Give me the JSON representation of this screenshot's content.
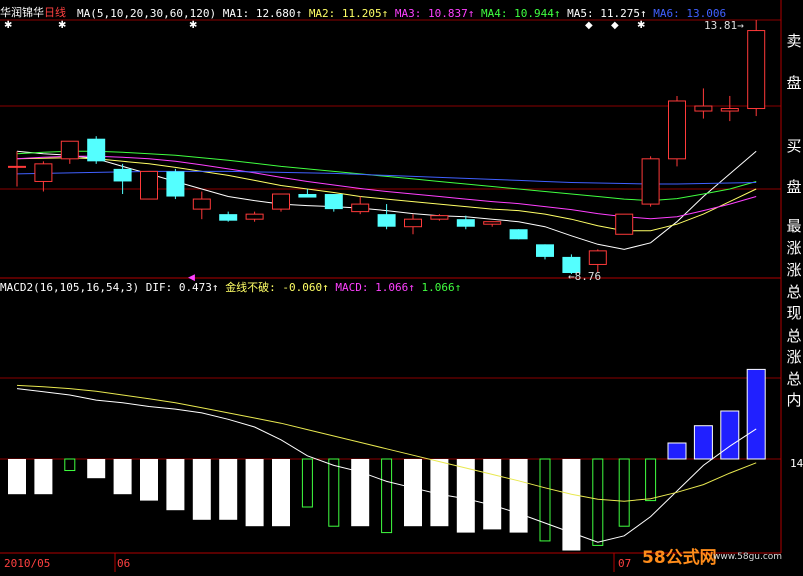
{
  "stock": {
    "name": "华润锦华",
    "period": "日线"
  },
  "ma_header": {
    "label": "MA(5,10,20,30,60,120)",
    "ma1": "MA1: 12.680↑",
    "ma2": "MA2: 11.205↑",
    "ma3": "MA3: 10.837↑",
    "ma4": "MA4: 10.944↑",
    "ma5": "MA5: 11.275↑",
    "ma6": "MA6: 13.006"
  },
  "macd_header": {
    "label": "MACD2(16,105,16,54,3)",
    "dif": "DIF: 0.473↑",
    "cross": "金线不破: -0.060↑",
    "macd": "MACD: 1.066↑",
    "extra": "1.066↑"
  },
  "annotations": {
    "high": "13.81",
    "low": "8.76",
    "right_value": "14"
  },
  "axis_dates": [
    "2010/05",
    "06",
    "07"
  ],
  "side_panel": [
    "卖",
    "盘",
    "买",
    "盘",
    "最",
    "涨",
    "涨",
    "总",
    "现",
    "总",
    "涨",
    "总",
    "内"
  ],
  "watermark": {
    "main": "58公式网",
    "url": "www.58gu.com"
  },
  "colors": {
    "up": "#ff3a3a",
    "down": "#54ffff",
    "grid": "#8a0000",
    "ma1": "#ffffff",
    "ma2": "#ffff66",
    "ma3": "#ff40ff",
    "ma4": "#40ff40",
    "ma5": "#4060ff",
    "dif": "#ffffff",
    "signal": "#e8e850"
  },
  "chart_data": {
    "type": "candlestick",
    "candles": [
      {
        "o": 10.9,
        "h": 11.2,
        "l": 10.5,
        "c": 10.9
      },
      {
        "o": 10.6,
        "h": 11.0,
        "l": 10.4,
        "c": 10.95
      },
      {
        "o": 11.05,
        "h": 11.4,
        "l": 10.95,
        "c": 11.4
      },
      {
        "o": 11.45,
        "h": 11.5,
        "l": 10.95,
        "c": 11.0
      },
      {
        "o": 10.85,
        "h": 10.95,
        "l": 10.35,
        "c": 10.6
      },
      {
        "o": 10.25,
        "h": 10.8,
        "l": 10.25,
        "c": 10.8
      },
      {
        "o": 10.8,
        "h": 10.85,
        "l": 10.25,
        "c": 10.3
      },
      {
        "o": 10.05,
        "h": 10.4,
        "l": 9.85,
        "c": 10.25
      },
      {
        "o": 9.95,
        "h": 10.0,
        "l": 9.8,
        "c": 9.82
      },
      {
        "o": 9.85,
        "h": 10.0,
        "l": 9.8,
        "c": 9.95
      },
      {
        "o": 10.05,
        "h": 10.35,
        "l": 10.0,
        "c": 10.35
      },
      {
        "o": 10.35,
        "h": 10.45,
        "l": 10.3,
        "c": 10.28
      },
      {
        "o": 10.35,
        "h": 10.35,
        "l": 10.0,
        "c": 10.05
      },
      {
        "o": 10.0,
        "h": 10.3,
        "l": 9.95,
        "c": 10.15
      },
      {
        "o": 9.95,
        "h": 10.15,
        "l": 9.65,
        "c": 9.7
      },
      {
        "o": 9.7,
        "h": 9.95,
        "l": 9.55,
        "c": 9.85
      },
      {
        "o": 9.85,
        "h": 9.95,
        "l": 9.82,
        "c": 9.92
      },
      {
        "o": 9.85,
        "h": 9.92,
        "l": 9.65,
        "c": 9.7
      },
      {
        "o": 9.75,
        "h": 9.8,
        "l": 9.7,
        "c": 9.8
      },
      {
        "o": 9.65,
        "h": 9.65,
        "l": 9.45,
        "c": 9.45
      },
      {
        "o": 9.35,
        "h": 9.35,
        "l": 9.05,
        "c": 9.1
      },
      {
        "o": 9.1,
        "h": 9.15,
        "l": 8.76,
        "c": 8.78
      },
      {
        "o": 8.95,
        "h": 9.25,
        "l": 8.8,
        "c": 9.22
      },
      {
        "o": 9.55,
        "h": 9.95,
        "l": 9.55,
        "c": 9.95
      },
      {
        "o": 10.15,
        "h": 11.1,
        "l": 10.1,
        "c": 11.05
      },
      {
        "o": 11.05,
        "h": 12.3,
        "l": 10.9,
        "c": 12.2
      },
      {
        "o": 12.0,
        "h": 12.45,
        "l": 11.85,
        "c": 12.1
      },
      {
        "o": 12.0,
        "h": 12.3,
        "l": 11.8,
        "c": 12.05
      },
      {
        "o": 12.05,
        "h": 13.81,
        "l": 11.9,
        "c": 13.6
      }
    ],
    "ma_lines": [
      {
        "name": "MA1",
        "values": [
          11.2,
          11.15,
          11.12,
          11.05,
          10.9,
          10.75,
          10.6,
          10.45,
          10.3,
          10.22,
          10.15,
          10.12,
          10.1,
          10.07,
          10.02,
          9.96,
          9.92,
          9.9,
          9.85,
          9.8,
          9.7,
          9.52,
          9.35,
          9.25,
          9.38,
          9.8,
          10.3,
          10.75,
          11.2
        ]
      },
      {
        "name": "MA2",
        "values": [
          11.05,
          11.06,
          11.07,
          11.05,
          11.0,
          10.95,
          10.88,
          10.8,
          10.72,
          10.62,
          10.52,
          10.45,
          10.38,
          10.3,
          10.25,
          10.2,
          10.15,
          10.1,
          10.05,
          10.02,
          9.95,
          9.85,
          9.72,
          9.62,
          9.62,
          9.75,
          9.95,
          10.2,
          10.45
        ]
      },
      {
        "name": "MA3",
        "values": [
          11.05,
          11.08,
          11.1,
          11.1,
          11.08,
          11.05,
          11.0,
          10.93,
          10.85,
          10.77,
          10.68,
          10.6,
          10.53,
          10.46,
          10.4,
          10.35,
          10.3,
          10.25,
          10.2,
          10.16,
          10.1,
          10.04,
          9.96,
          9.9,
          9.86,
          9.9,
          10.02,
          10.15,
          10.3
        ]
      },
      {
        "name": "MA4",
        "values": [
          11.15,
          11.18,
          11.2,
          11.2,
          11.18,
          11.15,
          11.12,
          11.07,
          11.02,
          10.96,
          10.9,
          10.85,
          10.8,
          10.75,
          10.7,
          10.65,
          10.6,
          10.55,
          10.5,
          10.45,
          10.4,
          10.35,
          10.3,
          10.25,
          10.22,
          10.26,
          10.35,
          10.45,
          10.6
        ]
      },
      {
        "name": "MA5",
        "values": [
          10.75,
          10.76,
          10.77,
          10.78,
          10.79,
          10.8,
          10.8,
          10.8,
          10.8,
          10.79,
          10.78,
          10.77,
          10.76,
          10.74,
          10.72,
          10.7,
          10.68,
          10.66,
          10.64,
          10.62,
          10.6,
          10.58,
          10.57,
          10.56,
          10.55,
          10.55,
          10.56,
          10.57,
          10.58
        ]
      }
    ],
    "macd": {
      "histogram": [
        -0.55,
        -0.55,
        -0.18,
        -0.3,
        -0.55,
        -0.65,
        -0.8,
        -0.95,
        -0.95,
        -1.05,
        -1.05,
        -0.75,
        -1.05,
        -1.05,
        -1.15,
        -1.05,
        -1.05,
        -1.15,
        -1.1,
        -1.15,
        -1.28,
        -1.43,
        -1.35,
        -1.05,
        -0.65,
        0.25,
        0.52,
        0.75,
        1.4
      ],
      "dif": [
        1.1,
        1.05,
        1.0,
        0.92,
        0.88,
        0.82,
        0.78,
        0.72,
        0.62,
        0.5,
        0.3,
        0.05,
        -0.1,
        -0.2,
        -0.35,
        -0.45,
        -0.55,
        -0.62,
        -0.72,
        -0.85,
        -1.0,
        -1.15,
        -1.3,
        -1.2,
        -0.9,
        -0.5,
        -0.1,
        0.2,
        0.47
      ],
      "signal": [
        1.15,
        1.13,
        1.1,
        1.06,
        1.0,
        0.94,
        0.88,
        0.8,
        0.72,
        0.64,
        0.56,
        0.46,
        0.36,
        0.26,
        0.16,
        0.06,
        -0.04,
        -0.14,
        -0.24,
        -0.34,
        -0.45,
        -0.55,
        -0.63,
        -0.66,
        -0.62,
        -0.52,
        -0.4,
        -0.22,
        -0.06
      ]
    }
  }
}
